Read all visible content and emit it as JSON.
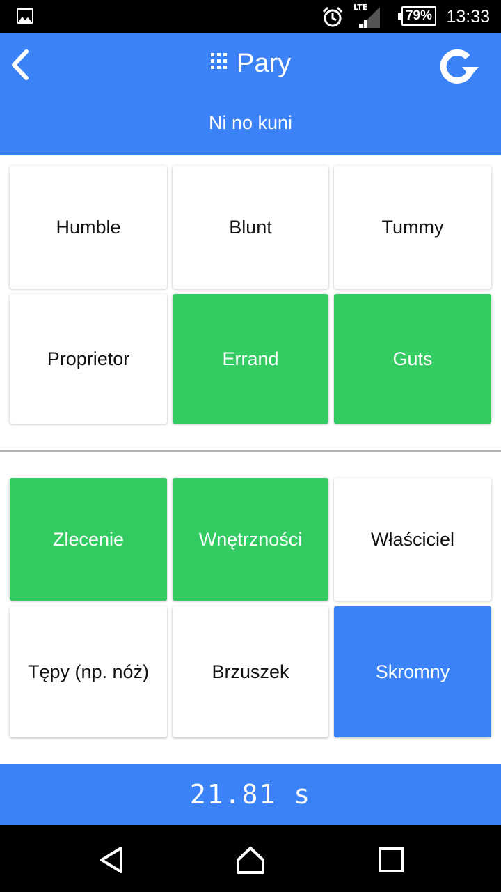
{
  "status_bar": {
    "network": "LTE",
    "battery": "79%",
    "time": "13:33",
    "icons": [
      "gallery-icon",
      "alarm-icon",
      "signal-icon",
      "battery-icon"
    ]
  },
  "header": {
    "title": "Pary",
    "subtitle": "Ni no kuni",
    "icons": [
      "back-icon",
      "grid-icon",
      "refresh-icon"
    ],
    "color": "#3b82f6"
  },
  "top_grid": [
    {
      "label": "Humble",
      "state": "default"
    },
    {
      "label": "Blunt",
      "state": "default"
    },
    {
      "label": "Tummy",
      "state": "default"
    },
    {
      "label": "Proprietor",
      "state": "default"
    },
    {
      "label": "Errand",
      "state": "matched"
    },
    {
      "label": "Guts",
      "state": "matched"
    }
  ],
  "bottom_grid": [
    {
      "label": "Zlecenie",
      "state": "matched"
    },
    {
      "label": "Wnętrzności",
      "state": "matched"
    },
    {
      "label": "Właściciel",
      "state": "default"
    },
    {
      "label": "Tępy (np. nóż)",
      "state": "default"
    },
    {
      "label": "Brzuszek",
      "state": "default"
    },
    {
      "label": "Skromny",
      "state": "selected"
    }
  ],
  "colors": {
    "matched": "#34cc62",
    "selected": "#3b82f6",
    "default": "#ffffff"
  },
  "timer": "21.81 s",
  "nav_bar": {
    "icons": [
      "back-triangle-icon",
      "home-icon",
      "recents-icon"
    ]
  }
}
